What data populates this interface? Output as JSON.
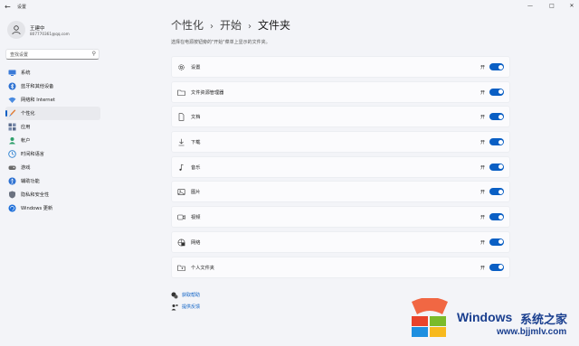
{
  "window": {
    "title": "设置",
    "back_icon": "arrow-left-icon",
    "controls": [
      "—",
      "□",
      "✕"
    ]
  },
  "user": {
    "name": "王建中",
    "email": "807770361@qq.com"
  },
  "search": {
    "placeholder": "查找设置",
    "icon": "search-icon"
  },
  "sidebar": {
    "items": [
      {
        "label": "系统",
        "icon": "monitor-icon",
        "color": "#3b7bd8",
        "active": false
      },
      {
        "label": "蓝牙和其他设备",
        "icon": "bluetooth-icon",
        "color": "#2a6fd1",
        "active": false
      },
      {
        "label": "网络和 Internet",
        "icon": "wifi-icon",
        "color": "#4a8be0",
        "active": false
      },
      {
        "label": "个性化",
        "icon": "brush-icon",
        "color": "#e07a30",
        "active": true
      },
      {
        "label": "应用",
        "icon": "apps-icon",
        "color": "#5a6b8c",
        "active": false
      },
      {
        "label": "帐户",
        "icon": "person-icon",
        "color": "#2fa06b",
        "active": false
      },
      {
        "label": "时间和语言",
        "icon": "globe-clock-icon",
        "color": "#2a7fd0",
        "active": false
      },
      {
        "label": "游戏",
        "icon": "gamepad-icon",
        "color": "#6b6b6b",
        "active": false
      },
      {
        "label": "辅助功能",
        "icon": "accessibility-icon",
        "color": "#2a6fd1",
        "active": false
      },
      {
        "label": "隐私和安全性",
        "icon": "shield-icon",
        "color": "#6b7280",
        "active": false
      },
      {
        "label": "Windows 更新",
        "icon": "windows-update-icon",
        "color": "#1e6fd9",
        "active": false
      }
    ]
  },
  "breadcrumb": {
    "items": [
      "个性化",
      "开始",
      "文件夹"
    ],
    "separator": "›"
  },
  "description": "选择在电源按钮旁的\"开始\"菜单上显示的文件夹。",
  "folders": [
    {
      "label": "设置",
      "icon": "gear-icon",
      "state": "开",
      "on": true
    },
    {
      "label": "文件资源管理器",
      "icon": "folder-explorer-icon",
      "state": "开",
      "on": true
    },
    {
      "label": "文档",
      "icon": "document-icon",
      "state": "开",
      "on": true
    },
    {
      "label": "下载",
      "icon": "download-icon",
      "state": "开",
      "on": true
    },
    {
      "label": "音乐",
      "icon": "music-icon",
      "state": "开",
      "on": true
    },
    {
      "label": "图片",
      "icon": "image-icon",
      "state": "开",
      "on": true
    },
    {
      "label": "视频",
      "icon": "video-icon",
      "state": "开",
      "on": true
    },
    {
      "label": "网络",
      "icon": "network-icon",
      "state": "开",
      "on": true
    },
    {
      "label": "个人文件夹",
      "icon": "personal-folder-icon",
      "state": "开",
      "on": true
    }
  ],
  "help_links": [
    {
      "label": "获取帮助",
      "icon": "help-icon"
    },
    {
      "label": "提供反馈",
      "icon": "feedback-icon"
    }
  ],
  "watermark": {
    "brand": "Windows",
    "cn": "系统之家",
    "url": "www.bjjmlv.com",
    "logo": "windows-logo-icon"
  },
  "colors": {
    "accent": "#0a5fc4",
    "background": "#f3f4f8"
  }
}
